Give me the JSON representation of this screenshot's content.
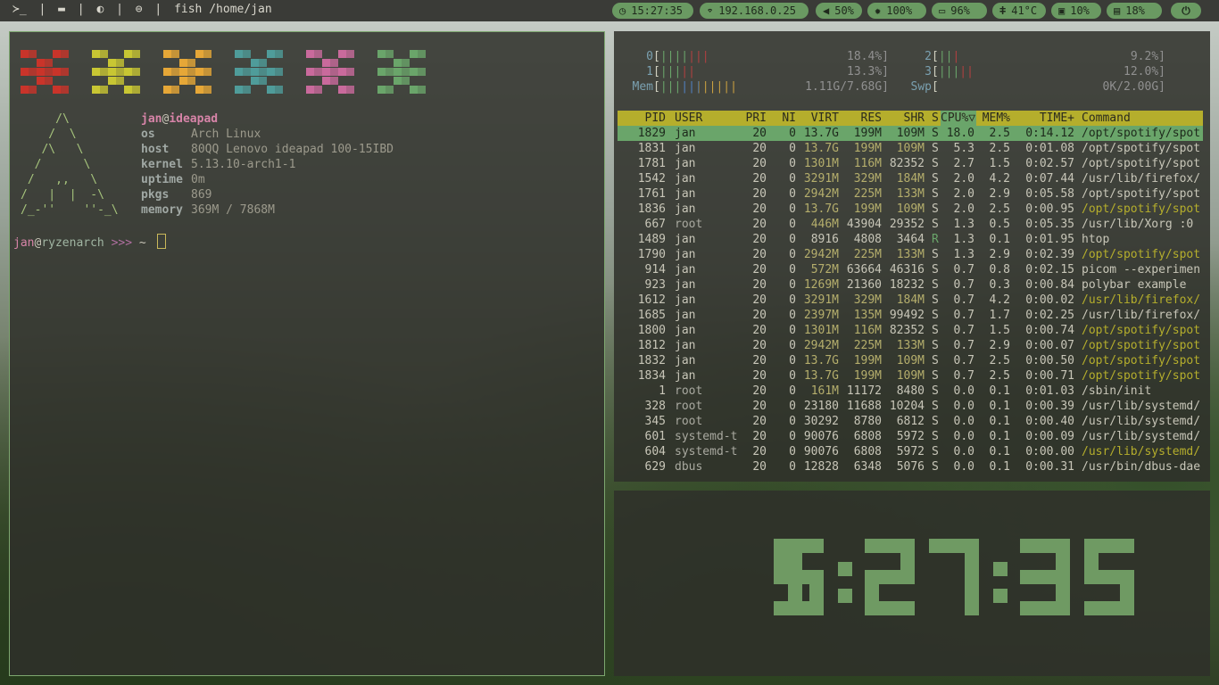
{
  "topbar": {
    "left_items": [
      "≻_",
      "|",
      "▬",
      "|",
      "◐",
      "|",
      "⊜",
      "|",
      "fish /home/jan"
    ],
    "pills": [
      {
        "icon": "clock-icon",
        "glyph": "◷",
        "value": "15:27:35"
      },
      {
        "icon": "wifi-icon",
        "glyph": "⌔",
        "value": "192.168.0.25"
      },
      {
        "icon": "volume-icon",
        "glyph": "◀",
        "value": "50%"
      },
      {
        "icon": "brightness-icon",
        "glyph": "✹",
        "value": "100%"
      },
      {
        "icon": "battery-icon",
        "glyph": "▭",
        "value": "96%"
      },
      {
        "icon": "thermometer-icon",
        "glyph": "ǂ",
        "value": "41°C"
      },
      {
        "icon": "cpu-icon",
        "glyph": "▣",
        "value": "10%"
      },
      {
        "icon": "memory-icon",
        "glyph": "▤",
        "value": "18%"
      },
      {
        "icon": "power-icon",
        "glyph": "⏻",
        "value": ""
      }
    ]
  },
  "terminal": {
    "block_colors": [
      "#c9342a",
      "#c8c633",
      "#e6a737",
      "#4f9c9a",
      "#c96a9c",
      "#6aa56a"
    ],
    "ascii": "     /\\\n    /  \\\n   /\\   \\\n  /      \\\n /   ,,   \\\n/   |  |  -\\\n/_-''    ''-_\\",
    "user": "jan",
    "at": "@",
    "host": "ideapad",
    "info": [
      {
        "key": "os",
        "value": "Arch Linux"
      },
      {
        "key": "host",
        "value": "80QQ Lenovo ideapad 100-15IBD"
      },
      {
        "key": "kernel",
        "value": "5.13.10-arch1-1"
      },
      {
        "key": "uptime",
        "value": "0m"
      },
      {
        "key": "pkgs",
        "value": "869"
      },
      {
        "key": "memory",
        "value": "369M / 7868M"
      }
    ],
    "prompt_user": "jan",
    "prompt_at": "@",
    "prompt_host": "ryzenarch",
    "prompt_arrows": " >>>",
    "prompt_dir": " ~ "
  },
  "htop": {
    "meters": [
      {
        "label": "0",
        "bracket_open": "[",
        "bars": "|||||||",
        "value": "18.4%]"
      },
      {
        "label": "1",
        "bracket_open": "[",
        "bars": "|||||",
        "value": "13.3%]"
      },
      {
        "label": "Mem",
        "bracket_open": "[",
        "bars": "|||||||||||",
        "value": "1.11G/7.68G]"
      },
      {
        "label": "2",
        "bracket_open": "[",
        "bars": "|||",
        "value": "9.2%]"
      },
      {
        "label": "3",
        "bracket_open": "[",
        "bars": "|||||",
        "value": "12.0%]"
      },
      {
        "label": "Swp",
        "bracket_open": "[",
        "bars": "",
        "value": "0K/2.00G]"
      }
    ],
    "headers": {
      "pid": "PID",
      "user": "USER",
      "pri": "PRI",
      "ni": "NI",
      "virt": "VIRT",
      "res": "RES",
      "shr": "SHR",
      "s": "S",
      "cpu": "CPU%▽",
      "mem": "MEM%",
      "time": "TIME+",
      "cmd": "Command"
    },
    "rows": [
      [
        "1829",
        "jan",
        "20",
        "0",
        "13.7G",
        "199M",
        "109M",
        "S",
        "18.0",
        "2.5",
        "0:14.12",
        "/opt/spotify/spot"
      ],
      [
        "1831",
        "jan",
        "20",
        "0",
        "13.7G",
        "199M",
        "109M",
        "S",
        "5.3",
        "2.5",
        "0:01.08",
        "/opt/spotify/spot"
      ],
      [
        "1781",
        "jan",
        "20",
        "0",
        "1301M",
        "116M",
        "82352",
        "S",
        "2.7",
        "1.5",
        "0:02.57",
        "/opt/spotify/spot"
      ],
      [
        "1542",
        "jan",
        "20",
        "0",
        "3291M",
        "329M",
        "184M",
        "S",
        "2.0",
        "4.2",
        "0:07.44",
        "/usr/lib/firefox/"
      ],
      [
        "1761",
        "jan",
        "20",
        "0",
        "2942M",
        "225M",
        "133M",
        "S",
        "2.0",
        "2.9",
        "0:05.58",
        "/opt/spotify/spot"
      ],
      [
        "1836",
        "jan",
        "20",
        "0",
        "13.7G",
        "199M",
        "109M",
        "S",
        "2.0",
        "2.5",
        "0:00.95",
        "/opt/spotify/spot"
      ],
      [
        "667",
        "root",
        "20",
        "0",
        "446M",
        "43904",
        "29352",
        "S",
        "1.3",
        "0.5",
        "0:05.35",
        "/usr/lib/Xorg :0"
      ],
      [
        "1489",
        "jan",
        "20",
        "0",
        "8916",
        "4808",
        "3464",
        "R",
        "1.3",
        "0.1",
        "0:01.95",
        "htop"
      ],
      [
        "1790",
        "jan",
        "20",
        "0",
        "2942M",
        "225M",
        "133M",
        "S",
        "1.3",
        "2.9",
        "0:02.39",
        "/opt/spotify/spot"
      ],
      [
        "914",
        "jan",
        "20",
        "0",
        "572M",
        "63664",
        "46316",
        "S",
        "0.7",
        "0.8",
        "0:02.15",
        "picom --experimen"
      ],
      [
        "923",
        "jan",
        "20",
        "0",
        "1269M",
        "21360",
        "18232",
        "S",
        "0.7",
        "0.3",
        "0:00.84",
        "polybar example"
      ],
      [
        "1612",
        "jan",
        "20",
        "0",
        "3291M",
        "329M",
        "184M",
        "S",
        "0.7",
        "4.2",
        "0:00.02",
        "/usr/lib/firefox/"
      ],
      [
        "1685",
        "jan",
        "20",
        "0",
        "2397M",
        "135M",
        "99492",
        "S",
        "0.7",
        "1.7",
        "0:02.25",
        "/usr/lib/firefox/"
      ],
      [
        "1800",
        "jan",
        "20",
        "0",
        "1301M",
        "116M",
        "82352",
        "S",
        "0.7",
        "1.5",
        "0:00.74",
        "/opt/spotify/spot"
      ],
      [
        "1812",
        "jan",
        "20",
        "0",
        "2942M",
        "225M",
        "133M",
        "S",
        "0.7",
        "2.9",
        "0:00.07",
        "/opt/spotify/spot"
      ],
      [
        "1832",
        "jan",
        "20",
        "0",
        "13.7G",
        "199M",
        "109M",
        "S",
        "0.7",
        "2.5",
        "0:00.50",
        "/opt/spotify/spot"
      ],
      [
        "1834",
        "jan",
        "20",
        "0",
        "13.7G",
        "199M",
        "109M",
        "S",
        "0.7",
        "2.5",
        "0:00.71",
        "/opt/spotify/spot"
      ],
      [
        "1",
        "root",
        "20",
        "0",
        "161M",
        "11172",
        "8480",
        "S",
        "0.0",
        "0.1",
        "0:01.03",
        "/sbin/init"
      ],
      [
        "328",
        "root",
        "20",
        "0",
        "23180",
        "11688",
        "10204",
        "S",
        "0.0",
        "0.1",
        "0:00.39",
        "/usr/lib/systemd/"
      ],
      [
        "345",
        "root",
        "20",
        "0",
        "30292",
        "8780",
        "6812",
        "S",
        "0.0",
        "0.1",
        "0:00.40",
        "/usr/lib/systemd/"
      ],
      [
        "601",
        "systemd-t",
        "20",
        "0",
        "90076",
        "6808",
        "5972",
        "S",
        "0.0",
        "0.1",
        "0:00.09",
        "/usr/lib/systemd/"
      ],
      [
        "604",
        "systemd-t",
        "20",
        "0",
        "90076",
        "6808",
        "5972",
        "S",
        "0.0",
        "0.1",
        "0:00.00",
        "/usr/lib/systemd/"
      ],
      [
        "629",
        "dbus",
        "20",
        "0",
        "12828",
        "6348",
        "5076",
        "S",
        "0.0",
        "0.1",
        "0:00.31",
        "/usr/bin/dbus-dae"
      ]
    ],
    "thread_rows": [
      5,
      8,
      11,
      13,
      14,
      15,
      16,
      21
    ]
  },
  "clock": {
    "time": "15:27:35",
    "color": "#6f9a63"
  }
}
